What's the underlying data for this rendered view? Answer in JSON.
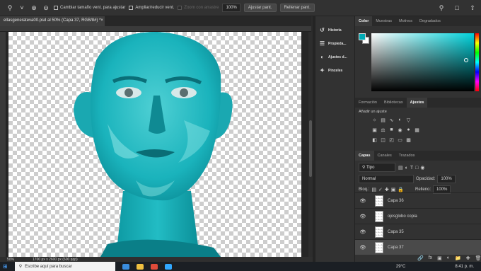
{
  "options_bar": {
    "zoom_tool_icon": "zoom-icon",
    "zoom_in_icon": "zoom-in-icon",
    "zoom_out_icon": "zoom-out-icon",
    "resize_windows": "Cambiar tamaño vent. para ajustar",
    "zoom_all_windows": "Ampliar/reducir vent.",
    "scrubby_zoom": "Zoom con arrastre",
    "zoom_value": "100%",
    "fit_screen": "Ajustar pant.",
    "fill_screen": "Rellenar pant."
  },
  "document": {
    "tab_title": "ellasgenerateva00.psd al 50% (Capa 37, RGB/8#) *",
    "close": "×",
    "zoom": "50%",
    "size": "1700 px x 2600 px (600 ppp)"
  },
  "side_panels": [
    {
      "label": "Historia",
      "icon": "history-icon"
    },
    {
      "label": "Propieda...",
      "icon": "properties-icon"
    },
    {
      "label": "Ajustes d...",
      "icon": "adjustments-icon"
    },
    {
      "label": "Pinceles",
      "icon": "brushes-icon"
    }
  ],
  "color_panel": {
    "tabs": [
      "Color",
      "Muestras",
      "Motivos",
      "Degradados"
    ],
    "active": 0,
    "foreground": "#00aab4",
    "background": "#ffffff",
    "hue_color": "#00d3dc"
  },
  "adjust_panel": {
    "tabs": [
      "Formación",
      "Bibliotecas",
      "Ajustes"
    ],
    "active": 2,
    "label": "Añadir un ajuste"
  },
  "layers_panel": {
    "tabs": [
      "Capas",
      "Canales",
      "Trazados"
    ],
    "active": 0,
    "kind": "Tipo",
    "blend_mode": "Normal",
    "opacity_label": "Opacidad:",
    "opacity": "100%",
    "lock_label": "Bloq.:",
    "fill_label": "Relleno:",
    "fill": "100%",
    "layers": [
      {
        "name": "Capa 36",
        "visible": true,
        "selected": false
      },
      {
        "name": "ojosglobo copia",
        "visible": true,
        "selected": false
      },
      {
        "name": "Capa 35",
        "visible": true,
        "selected": false
      },
      {
        "name": "Capa 37",
        "visible": true,
        "selected": true
      }
    ]
  },
  "taskbar": {
    "search_placeholder": "Escribe aquí para buscar",
    "temperature": "29°C",
    "time": "8:41 p. m."
  }
}
